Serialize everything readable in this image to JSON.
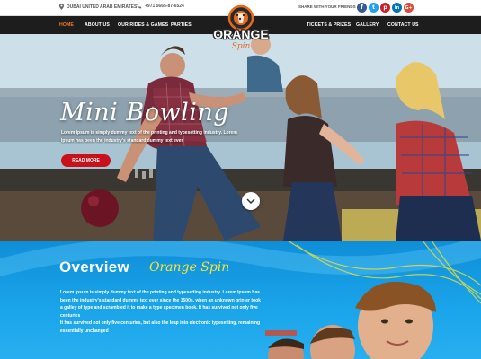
{
  "topbar": {
    "location": "DUBAI UNITED ARAB EMIRATES",
    "phone": "+971 5665-87-6524",
    "share_label": "SHARE WITH YOUR FRIENDS",
    "socials": [
      {
        "name": "facebook",
        "glyph": "f",
        "color": "#3b5998"
      },
      {
        "name": "twitter",
        "glyph": "t",
        "color": "#1da1f2"
      },
      {
        "name": "pinterest",
        "glyph": "p",
        "color": "#cb2027"
      },
      {
        "name": "linkedin",
        "glyph": "in",
        "color": "#0077b5"
      },
      {
        "name": "google-plus",
        "glyph": "G+",
        "color": "#dd4b39"
      }
    ]
  },
  "nav": {
    "home": "HOME",
    "about": "ABOUT US",
    "rides": "OUR RIDES & GAMES",
    "parties": "PARTIES",
    "tickets": "TICKETS & PRIZES",
    "gallery": "GALLERY",
    "contact": "CONTACT US",
    "active_color": "#f47b20"
  },
  "logo": {
    "main": "ORANGE",
    "sub": "Spin"
  },
  "hero": {
    "title": "Mini Bowling",
    "description": "Lorem Ipsum is simply dummy text of the printing and typesetting industry. Lorem Ipsum has been the industry's standard dummy text ever",
    "button": "READ MORE"
  },
  "overview": {
    "heading": "Overview",
    "subheading": "Orange Spin",
    "paragraph1": "Lorem Ipsum is simply dummy text of the printing and typesetting industry. Lorem Ipsum has been the industry's standard dummy text ever since the 1500s, when an unknown printer took a galley of type and scrambled it to make a type specimen book. It has survived not only five centuries",
    "paragraph2": "It has survived not only five centuries, but also the leap into electronic typesetting, remaining essentially unchanged"
  }
}
